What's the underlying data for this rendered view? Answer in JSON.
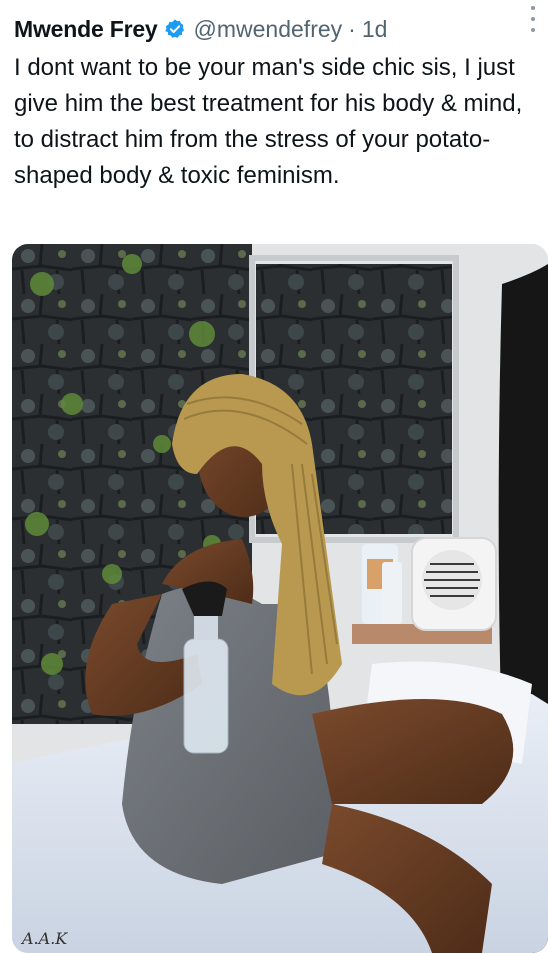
{
  "tweet": {
    "author": {
      "display_name": "Mwende Frey",
      "handle": "@mwendefrey",
      "verified": true,
      "verified_icon": "verified-badge-icon",
      "verified_color": "#1d9bf0"
    },
    "separator": "·",
    "time": "1d",
    "more_icon": "more-vertical-icon",
    "text": "I dont want to be your man's side chic sis, I just give him the best treatment for his body & mind, to distract him from the stress of your potato-shaped body & toxic feminism.",
    "media": {
      "kind": "photo",
      "watermark": "A.A.K"
    }
  }
}
